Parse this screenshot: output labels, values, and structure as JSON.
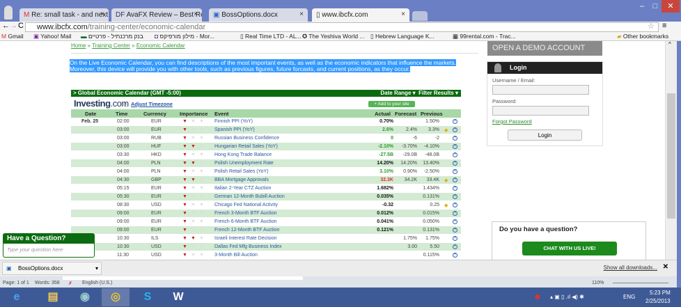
{
  "browser": {
    "tabs": [
      {
        "label": "Re: small task - and next t",
        "icon": "gmail-icon"
      },
      {
        "label": "AvaFX Review – Best Revie",
        "icon": "df-icon"
      },
      {
        "label": "BossOptions.docx",
        "icon": "doc-icon"
      },
      {
        "label": "www.ibcfx.com",
        "icon": "page-icon",
        "active": true
      }
    ],
    "url_host": "www.ibcfx.com",
    "url_path": "/training-center/economic-calendar",
    "bookmarks": [
      "Gmail",
      "Yahoo! Mail",
      "בנק מרכנתיל - פרטיים",
      "מילון מורפיקס - Mor...",
      "Real Time LTD - AL...",
      "The Yeshiva World ...",
      "Hebrew Language K...",
      "99rental.com - Trac..."
    ],
    "other_bookmarks": "Other bookmarks"
  },
  "page": {
    "breadcrumb": [
      "Home",
      "Training Center",
      "Economic Calendar"
    ],
    "intro": "On the Live Economic Calendar, you can find descriptions of the most important events, as well as the economic indicators that influence the markets. Moreover, this device will provide you with other tools, such as previous figures, future forcasts, and current positions, as they occur.",
    "calendar": {
      "title": "> Global Economic Calendar (GMT -5:00)",
      "date_range": "Date Range ▾",
      "filter": "Filter Results ▾",
      "logo": "Investing",
      "logo_suffix": ".com",
      "adjust_tz": "Adjust Timezone",
      "add_site": "Add to your site",
      "headers": {
        "date": "Date",
        "time": "Time",
        "currency": "Currency",
        "importance": "Importance",
        "event": "Event",
        "actual": "Actual",
        "forecast": "Forecast",
        "previous": "Previous"
      },
      "rows": [
        {
          "date": "Feb. 25",
          "time": "02:00",
          "cur": "EUR",
          "imp": 1,
          "event": "Finnish PPI (YoY)",
          "actual": "0.70%",
          "ac": "#111",
          "forecast": "",
          "previous": "1.50%"
        },
        {
          "date": "",
          "time": "03:00",
          "cur": "EUR",
          "imp": 1,
          "event": "Spanish PPI (YoY)",
          "actual": "2.6%",
          "ac": "#2a9a2a",
          "forecast": "2.4%",
          "previous": "3.3%",
          "star": true
        },
        {
          "date": "",
          "time": "03:00",
          "cur": "RUB",
          "imp": 1,
          "event": "Russian Business Confidence",
          "actual": "0",
          "ac": "#2a9a2a",
          "forecast": "-6",
          "previous": "-2"
        },
        {
          "date": "",
          "time": "03:00",
          "cur": "HUF",
          "imp": 2,
          "event": "Hungarian Retail Sales (YoY)",
          "actual": "-2.10%",
          "ac": "#2a9a2a",
          "forecast": "-3.70%",
          "previous": "-4.10%"
        },
        {
          "date": "",
          "time": "03:30",
          "cur": "HKD",
          "imp": 1,
          "event": "Hong Kong Trade Balance",
          "actual": "-27.5B",
          "ac": "#2a9a2a",
          "forecast": "-29.0B",
          "previous": "-48.0B"
        },
        {
          "date": "",
          "time": "04:00",
          "cur": "PLN",
          "imp": 2,
          "event": "Polish Unemployment Rate",
          "actual": "14.20%",
          "ac": "#111",
          "forecast": "14.20%",
          "previous": "13.40%"
        },
        {
          "date": "",
          "time": "04:00",
          "cur": "PLN",
          "imp": 1,
          "event": "Polish Retail Sales (YoY)",
          "actual": "3.10%",
          "ac": "#2a9a2a",
          "forecast": "0.90%",
          "previous": "-2.50%"
        },
        {
          "date": "",
          "time": "04:30",
          "cur": "GBP",
          "imp": 2,
          "event": "BBA Mortgage Approvals",
          "actual": "32.3K",
          "ac": "#e03030",
          "forecast": "34.2K",
          "previous": "33.4K",
          "star": true
        },
        {
          "date": "",
          "time": "05:15",
          "cur": "EUR",
          "imp": 1,
          "event": "Italian 2-Year CTZ Auction",
          "actual": "1.682%",
          "ac": "#111",
          "forecast": "",
          "previous": "1.434%"
        },
        {
          "date": "",
          "time": "05:30",
          "cur": "EUR",
          "imp": 1,
          "event": "German 12-Month Bubill Auction",
          "actual": "0.035%",
          "ac": "#111",
          "forecast": "",
          "previous": "0.131%"
        },
        {
          "date": "",
          "time": "08:30",
          "cur": "USD",
          "imp": 1,
          "event": "Chicago Fed National Activity",
          "actual": "-0.32",
          "ac": "#111",
          "forecast": "",
          "previous": "0.25",
          "star": true
        },
        {
          "date": "",
          "time": "09:00",
          "cur": "EUR",
          "imp": 1,
          "event": "French 3-Month BTF Auction",
          "actual": "0.012%",
          "ac": "#111",
          "forecast": "",
          "previous": "0.015%"
        },
        {
          "date": "",
          "time": "09:00",
          "cur": "EUR",
          "imp": 1,
          "event": "French 6-Month BTF Auction",
          "actual": "0.041%",
          "ac": "#111",
          "forecast": "",
          "previous": "0.050%"
        },
        {
          "date": "",
          "time": "09:00",
          "cur": "EUR",
          "imp": 1,
          "event": "French 12-Month BTF Auction",
          "actual": "0.121%",
          "ac": "#111",
          "forecast": "",
          "previous": "0.131%"
        },
        {
          "date": "",
          "time": "10:30",
          "cur": "ILS",
          "imp": 2,
          "event": "Israeli Interest Rate Decision",
          "actual": "",
          "ac": "#111",
          "forecast": "1.75%",
          "previous": "1.75%"
        },
        {
          "date": "",
          "time": "10:30",
          "cur": "USD",
          "imp": 1,
          "event": "Dallas Fed Mfg Business Index",
          "actual": "",
          "ac": "#111",
          "forecast": "3.00",
          "previous": "5.50"
        },
        {
          "date": "",
          "time": "11:30",
          "cur": "USD",
          "imp": 1,
          "event": "3-Month Bill Auction",
          "actual": "",
          "ac": "#111",
          "forecast": "",
          "previous": "0.115%"
        }
      ]
    },
    "demo": "OPEN A DEMO ACCOUNT",
    "login": {
      "title": "Login",
      "username_label": "Username / Email:",
      "password_label": "Password:",
      "forgot": "Forgot Password",
      "button": "Login"
    },
    "chat": {
      "title": "Do you have a question?",
      "button": "CHAT WITH US LIVE!"
    },
    "question": {
      "title": "Have a Question?",
      "placeholder": "Type your question here"
    }
  },
  "downloads": {
    "file": "BossOptions.docx",
    "show_all": "Show all downloads..."
  },
  "word": {
    "page": "Page: 1 of 1",
    "words": "Words: 358",
    "lang": "English (U.S.)",
    "zoom": "110%"
  },
  "taskbar": {
    "lang": "ENG",
    "time": "5:23 PM",
    "date": "2/25/2013"
  }
}
